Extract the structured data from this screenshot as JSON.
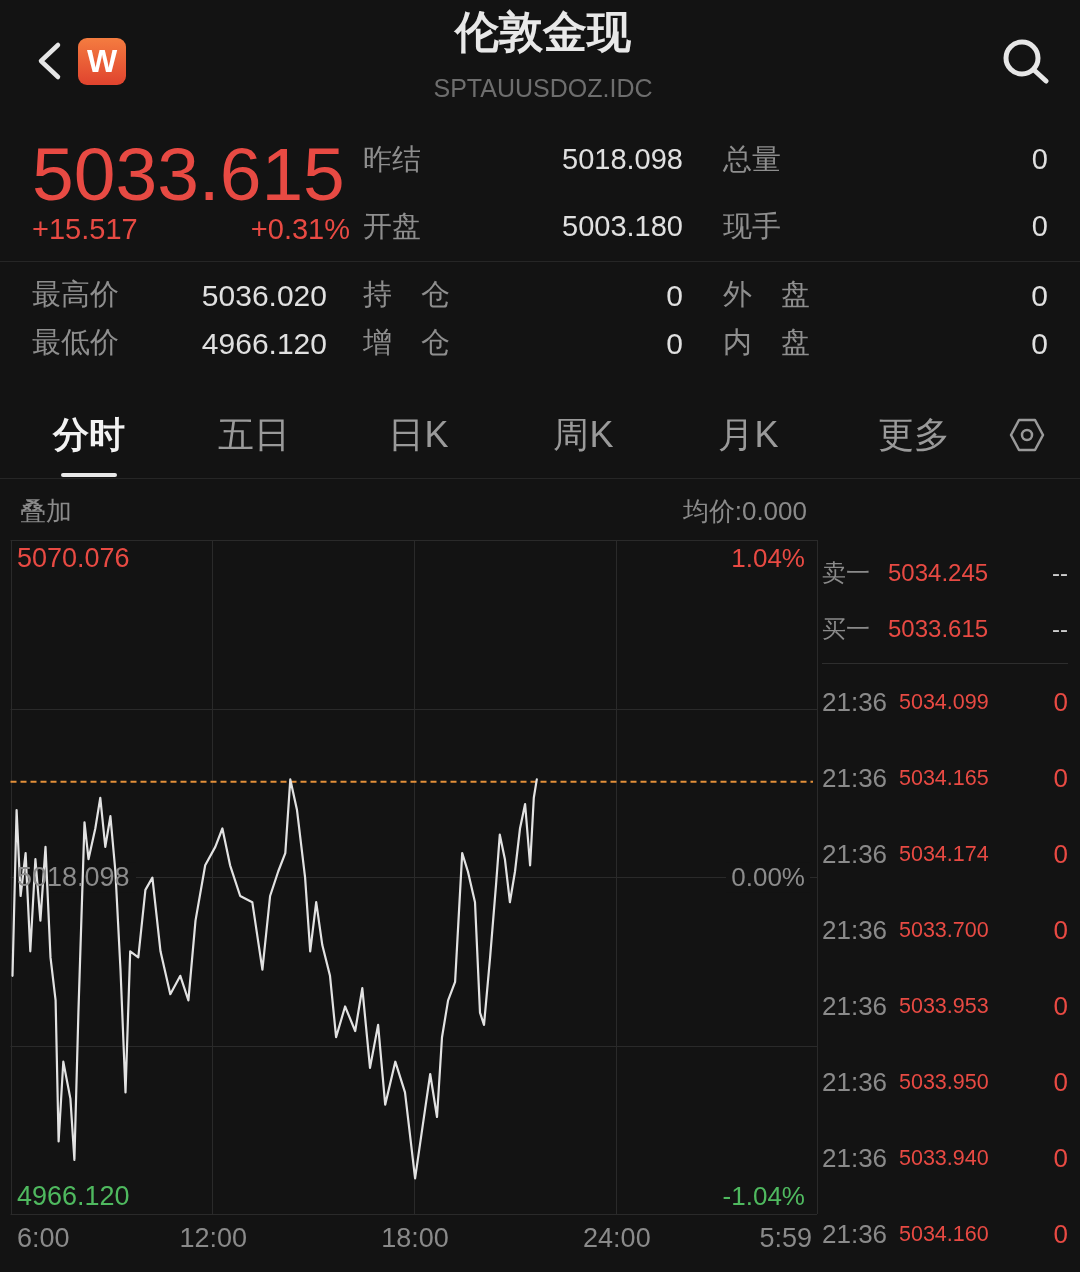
{
  "header": {
    "logo_text": "W",
    "title": "伦敦金现",
    "code": "SPTAUUSDOZ.IDC"
  },
  "quote": {
    "price": "5033.615",
    "change": "+15.517",
    "change_pct": "+0.31%",
    "stats": [
      {
        "label": "昨结",
        "value": "5018.098"
      },
      {
        "label": "总量",
        "value": "0"
      },
      {
        "label": "开盘",
        "value": "5003.180"
      },
      {
        "label": "现手",
        "value": "0"
      }
    ]
  },
  "stats_detail": [
    {
      "label": "最高价",
      "value": "5036.020"
    },
    {
      "label": "持 仓",
      "value": "0"
    },
    {
      "label": "外 盘",
      "value": "0"
    },
    {
      "label": "最低价",
      "value": "4966.120"
    },
    {
      "label": "增 仓",
      "value": "0"
    },
    {
      "label": "内 盘",
      "value": "0"
    }
  ],
  "tabs": [
    {
      "label": "分时",
      "selected": true
    },
    {
      "label": "五日",
      "selected": false
    },
    {
      "label": "日K",
      "selected": false
    },
    {
      "label": "周K",
      "selected": false
    },
    {
      "label": "月K",
      "selected": false
    },
    {
      "label": "更多",
      "selected": false
    }
  ],
  "chart": {
    "overlay": "叠加",
    "avg_price": "均价:0.000",
    "percent_labels": [
      {
        "text": "1.04%",
        "color": "#e84a43"
      },
      {
        "text": "0.00%",
        "color": "#8c8c8c"
      },
      {
        "text": "-1.04%",
        "color": "#4fb95f"
      }
    ],
    "axis_end_label": "5:59",
    "chart_data": {
      "type": "line",
      "x": [
        6.06,
        6.18,
        6.3,
        6.45,
        6.59,
        6.74,
        6.89,
        7.04,
        7.19,
        7.34,
        7.43,
        7.57,
        7.78,
        7.9,
        8.02,
        8.2,
        8.32,
        8.52,
        8.67,
        8.82,
        8.97,
        9.12,
        9.27,
        9.42,
        9.56,
        9.8,
        10.01,
        10.22,
        10.46,
        10.75,
        11.05,
        11.29,
        11.5,
        11.79,
        12.09,
        12.3,
        12.53,
        12.83,
        13.19,
        13.49,
        13.72,
        13.96,
        14.17,
        14.32,
        14.52,
        14.76,
        14.91,
        15.09,
        15.27,
        15.5,
        15.68,
        15.95,
        16.25,
        16.46,
        16.69,
        16.93,
        17.14,
        17.44,
        17.73,
        18.03,
        18.24,
        18.48,
        18.68,
        18.83,
        19.01,
        19.22,
        19.43,
        19.6,
        19.81,
        19.96,
        20.08,
        20.26,
        20.44,
        20.55,
        20.7,
        20.85,
        21.0,
        21.15,
        21.3,
        21.45,
        21.56,
        21.65
      ],
      "series": [
        {
          "values": [
            5002,
            5029,
            5015,
            5022,
            5006,
            5021,
            5011,
            5023,
            5005,
            4998,
            4975,
            4988,
            4982,
            4972,
            4996,
            5027,
            5021,
            5026,
            5031,
            5023,
            5028,
            5019,
            5003,
            4983,
            5006,
            5005,
            5016,
            5018,
            5006,
            4999,
            5002,
            4998,
            5011,
            5020,
            5023,
            5026,
            5020,
            5015,
            5014,
            5003,
            5015,
            5019,
            5022,
            5034,
            5029,
            5018,
            5006,
            5014,
            5007,
            5002,
            4992,
            4997,
            4993,
            5000,
            4987,
            4994,
            4981,
            4988,
            4983,
            4969,
            4977,
            4986,
            4979,
            4992,
            4998,
            5001,
            5022,
            5019,
            5014,
            4996,
            4994,
            5005,
            5017,
            5025,
            5021,
            5014,
            5019,
            5026,
            5030,
            5020,
            5031,
            5034
          ]
        }
      ],
      "xlim": [
        6,
        29.98
      ],
      "ylim": [
        4963.19,
        5073.01
      ],
      "grid": true,
      "xticks": [
        {
          "value": 6,
          "label": "6:00"
        },
        {
          "value": 12,
          "label": "12:00"
        },
        {
          "value": 18,
          "label": "18:00"
        },
        {
          "value": 24,
          "label": "24:00"
        }
      ],
      "yticks": [
        {
          "value": 4966.12,
          "label": "4966.120"
        },
        {
          "value": 5018.098,
          "label": "5018.098"
        },
        {
          "value": 5070.076,
          "label": "5070.076"
        }
      ],
      "ref_lines": [
        {
          "axis": "y",
          "value": 5033.615
        }
      ]
    }
  },
  "order_book": [
    {
      "label": "卖一",
      "price": "5034.245",
      "volume": "--"
    },
    {
      "label": "买一",
      "price": "5033.615",
      "volume": "--"
    }
  ],
  "trades": [
    {
      "time": "21:36",
      "price": "5034.099",
      "volume": "0"
    },
    {
      "time": "21:36",
      "price": "5034.165",
      "volume": "0"
    },
    {
      "time": "21:36",
      "price": "5034.174",
      "volume": "0"
    },
    {
      "time": "21:36",
      "price": "5033.700",
      "volume": "0"
    },
    {
      "time": "21:36",
      "price": "5033.953",
      "volume": "0"
    },
    {
      "time": "21:36",
      "price": "5033.950",
      "volume": "0"
    },
    {
      "time": "21:36",
      "price": "5033.940",
      "volume": "0"
    },
    {
      "time": "21:36",
      "price": "5034.160",
      "volume": "0"
    }
  ]
}
